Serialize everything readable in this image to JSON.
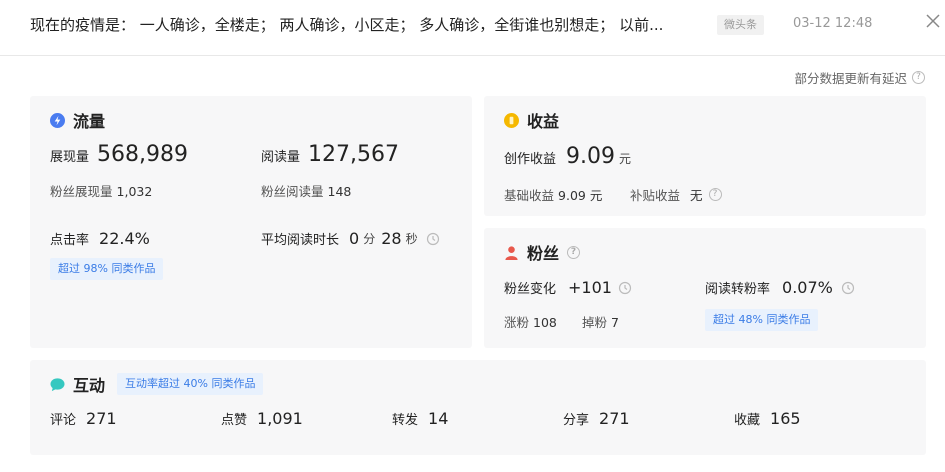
{
  "header": {
    "title": "现在的疫情是： 一人确诊，全楼走； 两人确诊，小区走； 多人确诊，全街谁也别想走； 以前...",
    "source": "微头条",
    "time": "03-12 12:48"
  },
  "delay_note": "部分数据更新有延迟",
  "traffic": {
    "title": "流量",
    "impressions_label": "展现量",
    "impressions": "568,989",
    "fan_impressions_label": "粉丝展现量",
    "fan_impressions": "1,032",
    "reads_label": "阅读量",
    "reads": "127,567",
    "fan_reads_label": "粉丝阅读量",
    "fan_reads": "148",
    "ctr_label": "点击率",
    "ctr": "22.4%",
    "ctr_badge": "超过 98% 同类作品",
    "avg_read_label": "平均阅读时长",
    "avg_read_min": "0",
    "min_unit": "分",
    "avg_read_sec": "28",
    "sec_unit": "秒"
  },
  "income": {
    "title": "收益",
    "creation_label": "创作收益",
    "creation_value": "9.09",
    "currency_unit": "元",
    "base_label": "基础收益",
    "base_value": "9.09 元",
    "subsidy_label": "补贴收益",
    "subsidy_value": "无"
  },
  "fans": {
    "title": "粉丝",
    "change_label": "粉丝变化",
    "change_value": "+101",
    "gain_label": "涨粉",
    "gain_value": "108",
    "loss_label": "掉粉",
    "loss_value": "7",
    "conversion_label": "阅读转粉率",
    "conversion_value": "0.07%",
    "conversion_badge": "超过 48% 同类作品"
  },
  "interaction": {
    "title": "互动",
    "badge": "互动率超过 40% 同类作品",
    "items": [
      {
        "label": "评论",
        "value": "271"
      },
      {
        "label": "点赞",
        "value": "1,091"
      },
      {
        "label": "转发",
        "value": "14"
      },
      {
        "label": "分享",
        "value": "271"
      },
      {
        "label": "收藏",
        "value": "165"
      }
    ]
  },
  "colors": {
    "traffic_icon": "#4a7cf0",
    "income_icon": "#f5b800",
    "fans_icon": "#e8584c",
    "interaction_icon": "#36c8c0",
    "badge_bg": "#e8f1fd",
    "badge_text": "#3a7ce6"
  },
  "icons": {
    "traffic": "lightning-icon",
    "income": "coin-icon",
    "fans": "person-icon",
    "interaction": "chat-bubble-icon",
    "close": "close-icon",
    "help": "question-icon",
    "history": "clock-icon"
  }
}
